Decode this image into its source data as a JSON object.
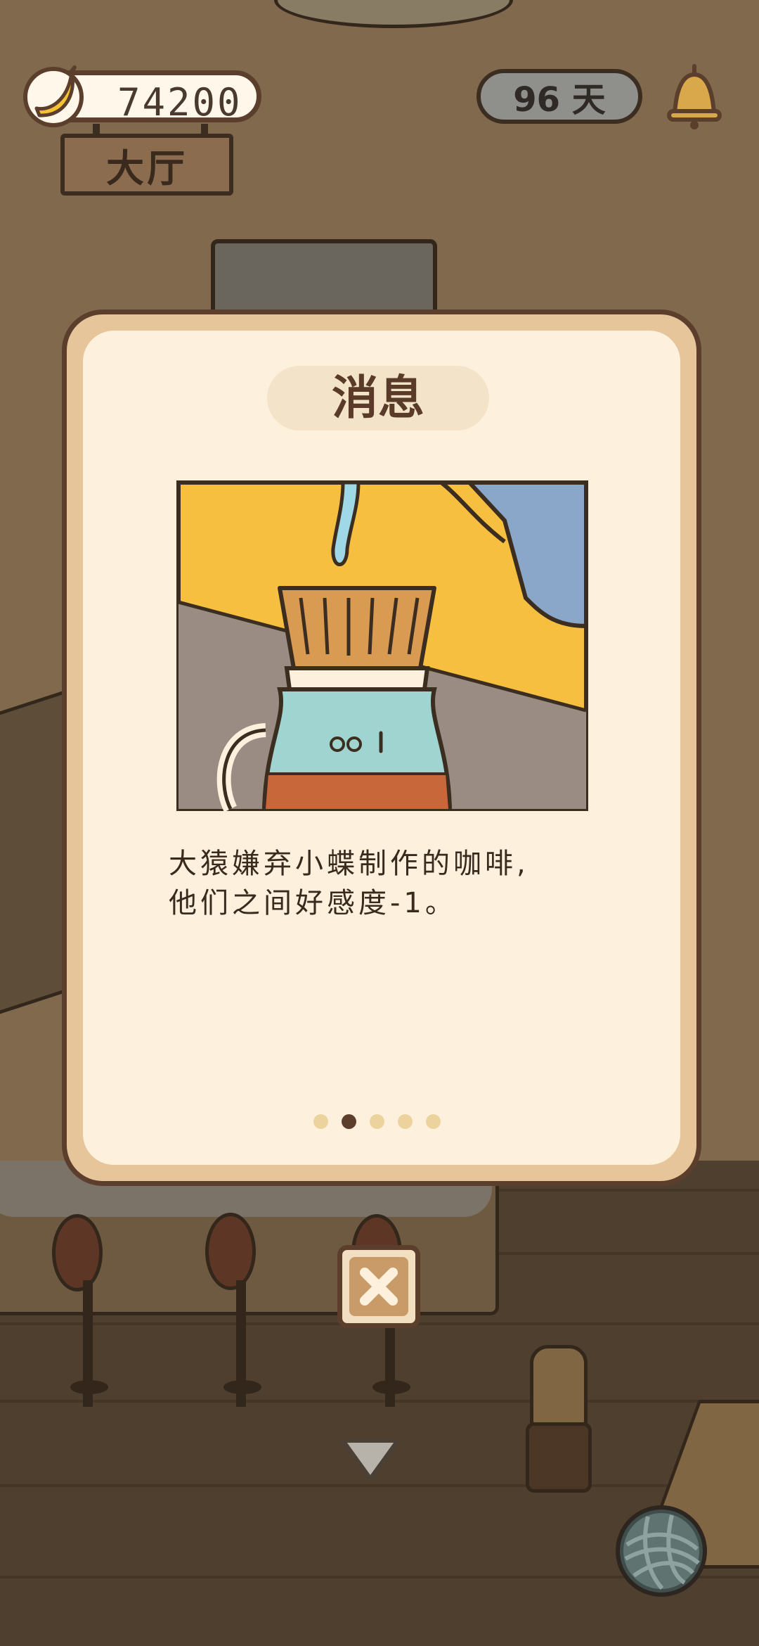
{
  "hud": {
    "coins": "74200",
    "location": "大厅",
    "days": "96 天"
  },
  "modal": {
    "title": "消息",
    "message_lines": [
      "大猿嫌弃小蝶制作的咖啡,",
      "他们之间好感度-1。"
    ],
    "page_count": 5,
    "current_page_index": 1,
    "illustration": "coffee-pour-over-icon"
  },
  "controls": {
    "close_icon": "close-icon",
    "scroll_down_icon": "chevron-down-icon",
    "yarn_icon": "yarn-ball-icon",
    "bell_icon": "bell-icon",
    "coin_icon": "banana-icon"
  },
  "colors": {
    "modal_border": "#5b3f2c",
    "modal_bg": "#fdf1de",
    "accent_yellow": "#f6bf3f",
    "active_dot": "#5b3f2c",
    "inactive_dot": "#ecd39d"
  }
}
